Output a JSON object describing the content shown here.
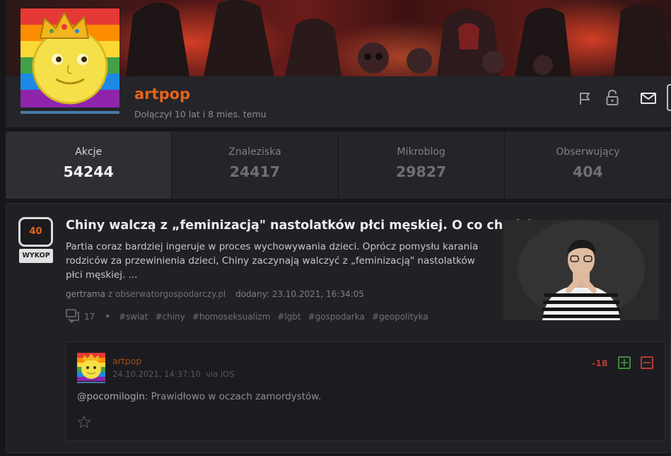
{
  "profile": {
    "username": "artpop",
    "joined": "Dołączył 10 lat i 8 mies. temu",
    "actions": {
      "report_icon": "flag-icon",
      "block_icon": "lock-icon",
      "message_icon": "envelope-icon"
    }
  },
  "stats": [
    {
      "label": "Akcje",
      "value": "54244",
      "active": true
    },
    {
      "label": "Znaleziska",
      "value": "24417",
      "active": false
    },
    {
      "label": "Mikroblog",
      "value": "29827",
      "active": false
    },
    {
      "label": "Obserwujący",
      "value": "404",
      "active": false
    }
  ],
  "link": {
    "votes": "40",
    "vote_button": "WYKOP",
    "title": "Chiny walczą z „feminizacją\" nastolatków płci męskiej. O co chodzi?",
    "description": "Partia coraz bardziej ingeruje w proces wychowywania dzieci. Oprócz pomysłu karania rodziców za przewinienia dzieci, Chiny zaczynają walczyć z „feminizacją\" nastolatków płci męskiej.  ...",
    "author": "gertrama",
    "source_prefix": "z",
    "source": "obserwatorgospodarczy.pl",
    "added": "dodany: 23.10.2021, 16:34:05",
    "comments_count": "17",
    "tags": [
      "#swiat",
      "#chiny",
      "#homoseksualizm",
      "#lgbt",
      "#gospodarka",
      "#geopolityka"
    ]
  },
  "comment": {
    "user": "artpop",
    "date": "24.10.2021, 14:37:10",
    "via": "via iOS",
    "score": "-18",
    "mention": "@pocomilogin",
    "text": ": Prawidłowo w oczach zamordystów."
  },
  "colors": {
    "accent": "#e4641b",
    "background": "#17171a",
    "panel": "#242429",
    "plus": "#3f8a3f",
    "minus": "#b43b34"
  }
}
